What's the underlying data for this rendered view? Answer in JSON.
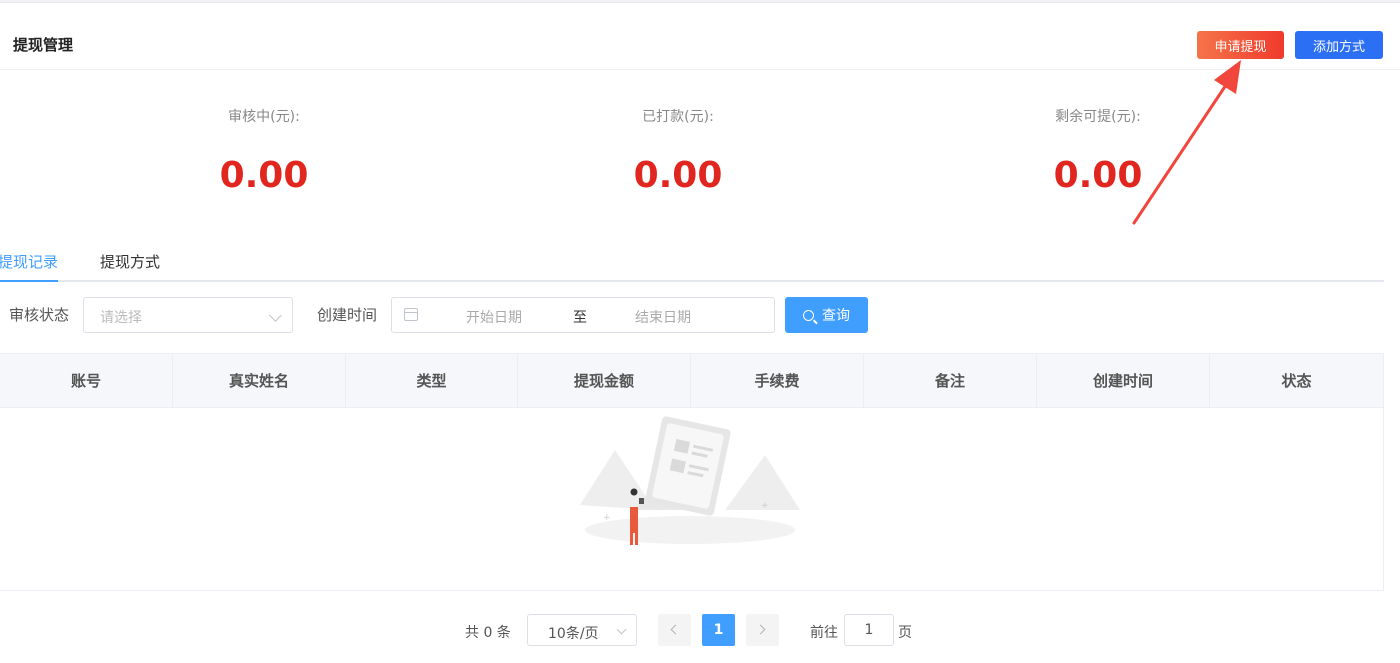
{
  "header": {
    "title": "提现管理",
    "apply_button": "申请提现",
    "add_button": "添加方式",
    "apply_gradient": [
      "#f5744a",
      "#f03a2c"
    ],
    "add_color": "#2b6ff5"
  },
  "stats": [
    {
      "label": "审核中(元):",
      "value": "0.00"
    },
    {
      "label": "已打款(元):",
      "value": "0.00"
    },
    {
      "label": "剩余可提(元):",
      "value": "0.00"
    }
  ],
  "stat_value_color": "#e0261f",
  "tabs": [
    {
      "label": "提现记录",
      "active": true
    },
    {
      "label": "提现方式",
      "active": false
    }
  ],
  "filters": {
    "status_label": "审核状态",
    "status_placeholder": "请选择",
    "time_label": "创建时间",
    "start_placeholder": "开始日期",
    "range_separator": "至",
    "end_placeholder": "结束日期",
    "search_button": "查询"
  },
  "table": {
    "columns": [
      "账号",
      "真实姓名",
      "类型",
      "提现金额",
      "手续费",
      "备注",
      "创建时间",
      "状态"
    ],
    "rows": []
  },
  "pagination": {
    "total_text": "共 0 条",
    "page_size": "10条/页",
    "current_page": "1",
    "goto_label": "前往",
    "goto_value": "1",
    "goto_unit": "页"
  },
  "icons": {
    "calendar": "calendar-icon",
    "search": "search-icon",
    "select_arrow": "chevron-down-icon",
    "prev": "chevron-left-icon",
    "next": "chevron-right-icon"
  },
  "accent_color": "#409eff",
  "annotation_color": "#f0463c"
}
